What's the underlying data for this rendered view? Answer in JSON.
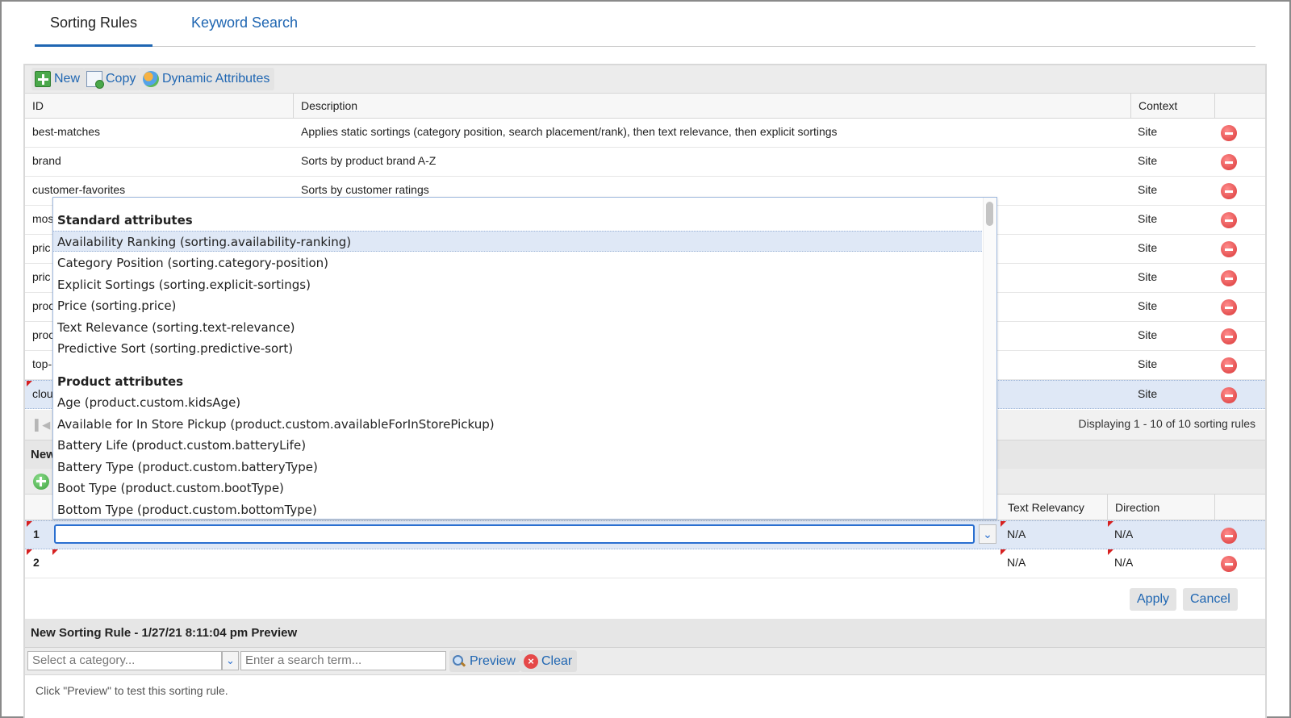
{
  "tabs": [
    {
      "label": "Sorting Rules",
      "active": true
    },
    {
      "label": "Keyword Search",
      "active": false
    }
  ],
  "toolbar": {
    "new_label": "New",
    "copy_label": "Copy",
    "dynamic_label": "Dynamic Attributes"
  },
  "grid": {
    "columns": [
      "ID",
      "Description",
      "Context"
    ],
    "rows": [
      {
        "id": "best-matches",
        "description": "Applies static sortings (category position, search placement/rank), then text relevance, then explicit sortings",
        "context": "Site"
      },
      {
        "id": "brand",
        "description": "Sorts by product brand A-Z",
        "context": "Site"
      },
      {
        "id": "customer-favorites",
        "description": "Sorts by customer ratings",
        "context": "Site"
      },
      {
        "id": "mos",
        "description": "",
        "context": "Site"
      },
      {
        "id": "pric",
        "description": "",
        "context": "Site"
      },
      {
        "id": "pric",
        "description": "",
        "context": "Site"
      },
      {
        "id": "proc",
        "description": "",
        "context": "Site"
      },
      {
        "id": "proc",
        "description": "",
        "context": "Site"
      },
      {
        "id": "top-",
        "description": "",
        "context": "Site"
      },
      {
        "id": "clou",
        "description": "",
        "context": "Site"
      }
    ]
  },
  "pager": {
    "info": "Displaying 1 - 10 of 10 sorting rules"
  },
  "new_rule": {
    "header": "New",
    "columns": [
      "Text Relevancy",
      "Direction"
    ],
    "rows": [
      {
        "num": "1",
        "text_relevancy": "N/A",
        "direction": "N/A"
      },
      {
        "num": "2",
        "text_relevancy": "N/A",
        "direction": "N/A"
      }
    ]
  },
  "actions": {
    "apply": "Apply",
    "cancel": "Cancel"
  },
  "preview": {
    "title": "New Sorting Rule - 1/27/21 8:11:04 pm Preview",
    "category_placeholder": "Select a category...",
    "search_placeholder": "Enter a search term...",
    "preview_label": "Preview",
    "clear_label": "Clear",
    "hint": "Click \"Preview\" to test this sorting rule."
  },
  "dropdown": {
    "groups": [
      {
        "label": "Standard attributes",
        "items": [
          "Availability Ranking (sorting.availability-ranking)",
          "Category Position (sorting.category-position)",
          "Explicit Sortings (sorting.explicit-sortings)",
          "Price (sorting.price)",
          "Text Relevance (sorting.text-relevance)",
          "Predictive Sort (sorting.predictive-sort)"
        ]
      },
      {
        "label": "Product attributes",
        "items": [
          "Age (product.custom.kidsAge)",
          "Available for In Store Pickup (product.custom.availableForInStorePickup)",
          "Battery Life (product.custom.batteryLife)",
          "Battery Type (product.custom.batteryType)",
          "Boot Type (product.custom.bootType)",
          "Bottom Type (product.custom.bottomType)"
        ]
      }
    ]
  },
  "colors": {
    "accent": "#1f66b2",
    "selected_row": "#dfe8f6",
    "delete": "#d93636"
  }
}
